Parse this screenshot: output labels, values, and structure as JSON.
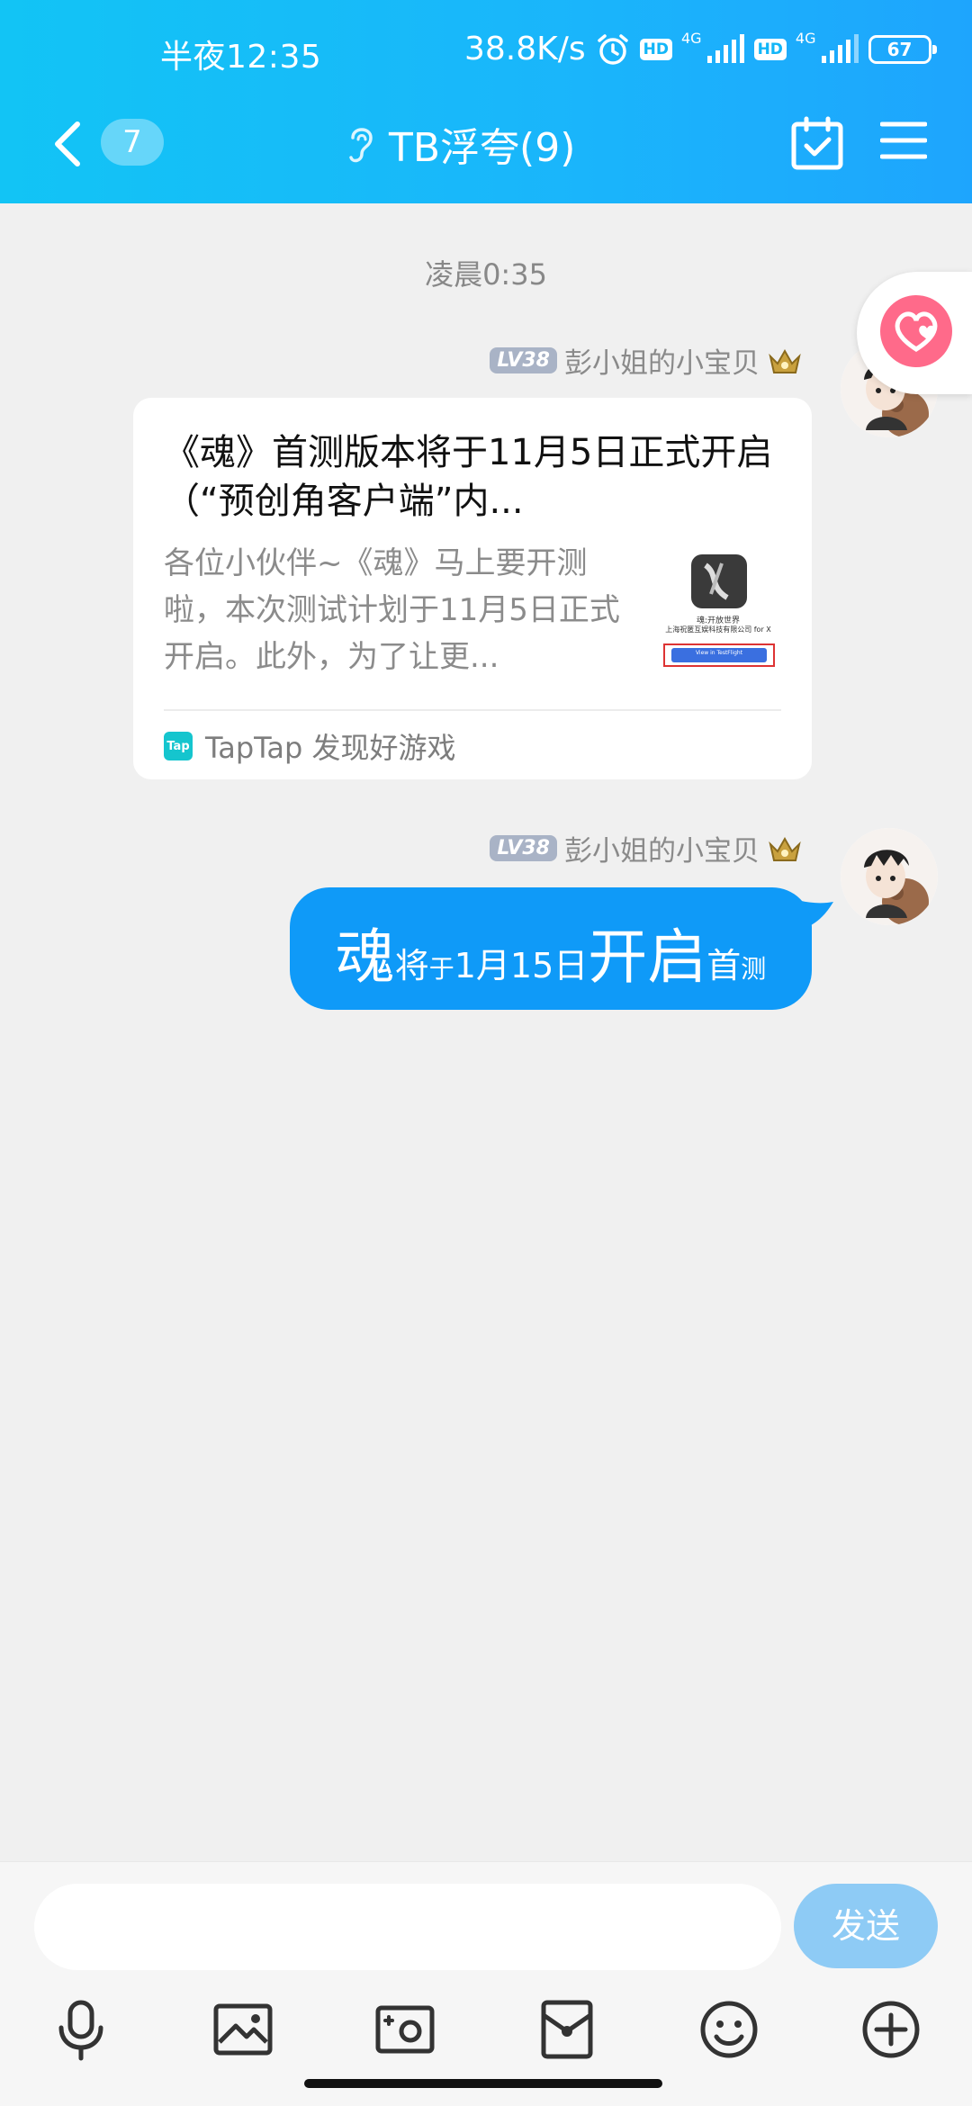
{
  "status_bar": {
    "time": "半夜12:35",
    "speed": "38.8K/s",
    "hd1": "HD",
    "net1": "4G",
    "hd2": "HD",
    "net2": "4G",
    "battery": "67"
  },
  "header": {
    "unread_count": "7",
    "title": "TB浮夸(9)",
    "accent_gradient": [
      "#12c4f5",
      "#1ea5fd"
    ]
  },
  "chat": {
    "timestamp": "凌晨0:35",
    "messages": [
      {
        "sender_level": "LV38",
        "sender_name": "彭小姐的小宝贝",
        "card": {
          "title": "《魂》首测版本将于11月5日正式开启（“预创角客户端”内...",
          "desc": "各位小伙伴~《魂》马上要开测啦，本次测试计划于11月5日正式开启。此外，为了让更...",
          "source": "TapTap 发现好游戏",
          "source_logo": "Tap",
          "thumb_caption1": "魂:开放世界",
          "thumb_caption2": "上海祝匿互娱科技有限公司 for X",
          "thumb_button": "View in TestFlight"
        }
      },
      {
        "sender_level": "LV38",
        "sender_name": "彭小姐的小宝贝",
        "bubble_parts": [
          "魂",
          "将",
          "于",
          "1月15日",
          "开启",
          "首",
          "测"
        ],
        "bubble_color": "#0f9af8"
      }
    ]
  },
  "input": {
    "placeholder": "",
    "send_label": "发送"
  },
  "toolbar": [
    "mic-icon",
    "image-icon",
    "camera-icon",
    "red-packet-icon",
    "emoji-icon",
    "plus-icon"
  ]
}
